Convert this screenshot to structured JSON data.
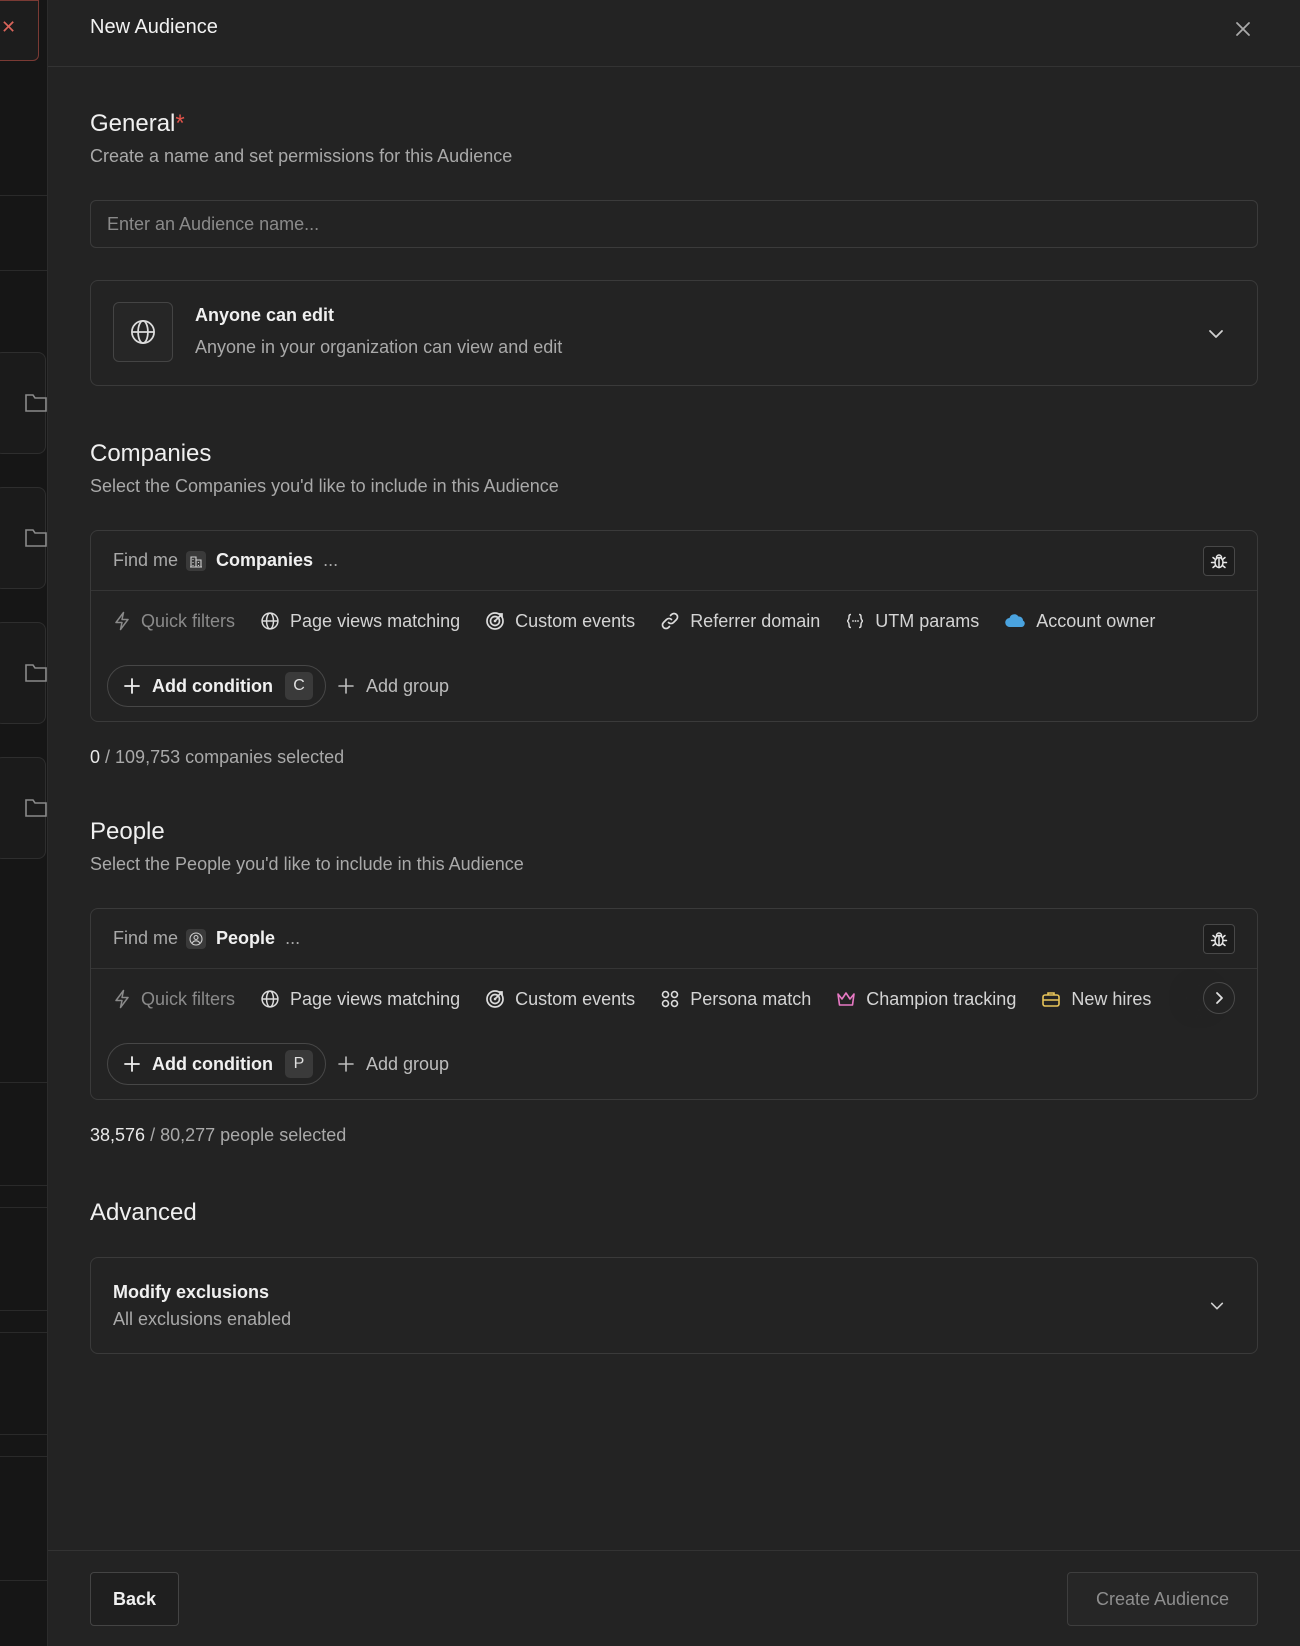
{
  "backdrop": {
    "close_glyph": "✕"
  },
  "drawer": {
    "title": "New Audience"
  },
  "general": {
    "title": "General",
    "required_mark": "*",
    "subtitle": "Create a name and set permissions for this Audience",
    "name_placeholder": "Enter an Audience name...",
    "permission": {
      "title": "Anyone can edit",
      "subtitle": "Anyone in your organization can view and edit"
    }
  },
  "companies": {
    "title": "Companies",
    "subtitle": "Select the Companies you'd like to include in this Audience",
    "find_me": "Find me",
    "entity": "Companies",
    "dots": "...",
    "quick_filters": [
      "Quick filters",
      "Page views matching",
      "Custom events",
      "Referrer domain",
      "UTM params",
      "Account owner"
    ],
    "add_condition": "Add condition",
    "shortcut": "C",
    "add_group": "Add group",
    "selected": "0",
    "total_text": "/ 109,753 companies selected"
  },
  "people": {
    "title": "People",
    "subtitle": "Select the People you'd like to include in this Audience",
    "find_me": "Find me",
    "entity": "People",
    "dots": "...",
    "quick_filters": [
      "Quick filters",
      "Page views matching",
      "Custom events",
      "Persona match",
      "Champion tracking",
      "New hires"
    ],
    "add_condition": "Add condition",
    "shortcut": "P",
    "add_group": "Add group",
    "selected": "38,576",
    "total_text": "/ 80,277 people selected"
  },
  "advanced": {
    "title": "Advanced",
    "exclusions_title": "Modify exclusions",
    "exclusions_subtitle": "All exclusions enabled"
  },
  "footer": {
    "back": "Back",
    "create": "Create Audience"
  },
  "colors": {
    "required": "#e0534a",
    "salesforce": "#4aa3df",
    "crown": "#e879c4",
    "briefcase": "#e8c45a"
  },
  "icons": [
    "close-icon",
    "globe-icon",
    "chevron-down-icon",
    "building-icon",
    "person-icon",
    "bug-icon",
    "lightning-icon",
    "target-icon",
    "link-icon",
    "braces-icon",
    "cloud-icon",
    "grid-icon",
    "crown-icon",
    "briefcase-icon",
    "plus-icon",
    "chevron-right-icon",
    "folder-icon"
  ]
}
